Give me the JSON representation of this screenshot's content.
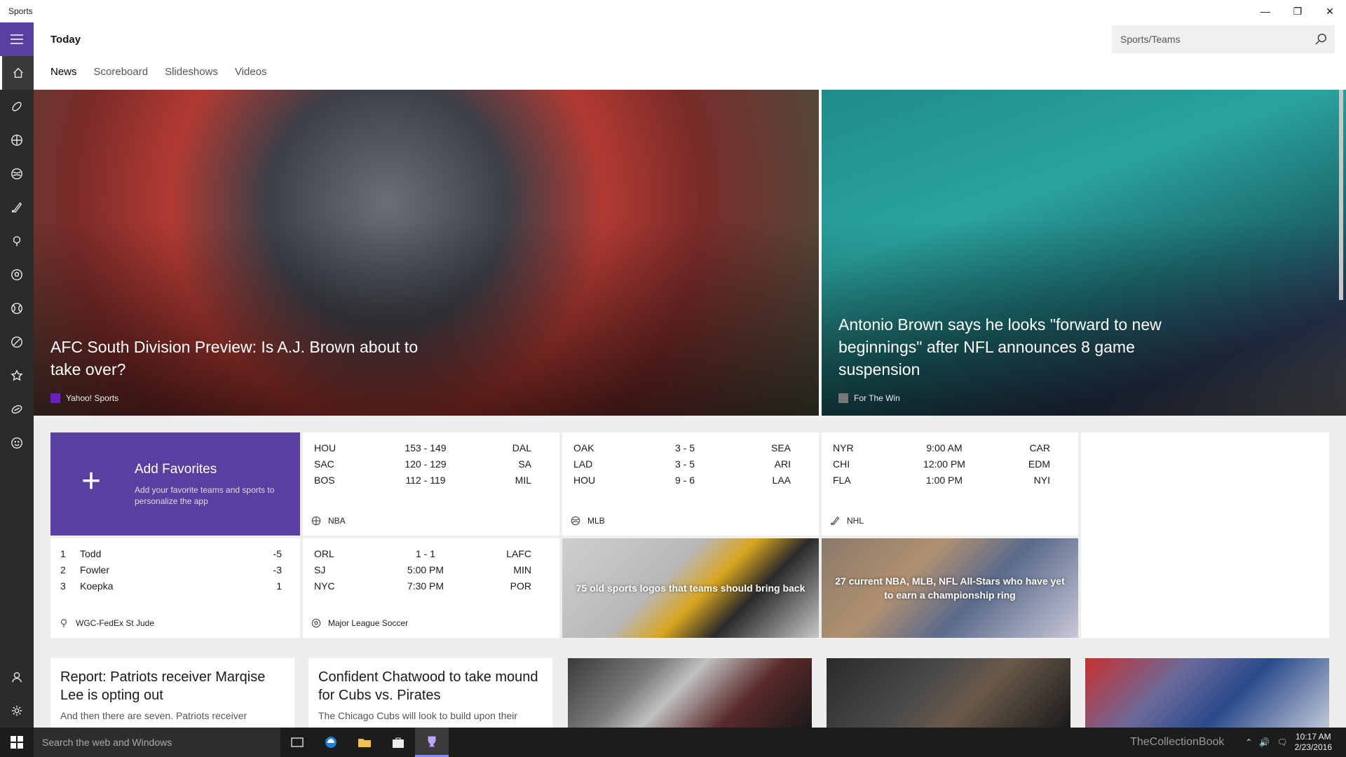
{
  "window": {
    "title": "Sports",
    "minimize": "—",
    "restore": "❐",
    "close": "✕"
  },
  "header": {
    "page_title": "Today",
    "search_placeholder": "Sports/Teams",
    "tabs": [
      {
        "label": "News",
        "active": true
      },
      {
        "label": "Scoreboard"
      },
      {
        "label": "Slideshows"
      },
      {
        "label": "Videos"
      }
    ]
  },
  "nav_icons": [
    "home-icon",
    "football-icon",
    "basketball-icon",
    "baseball-icon",
    "hockey-icon",
    "golf-icon",
    "soccer-icon",
    "tennis-icon",
    "cricket-icon",
    "fantasy-icon",
    "rugby-icon",
    "more-sports-icon"
  ],
  "hero": [
    {
      "headline": "AFC South Division Preview: Is A.J. Brown about to take over?",
      "source": "Yahoo! Sports"
    },
    {
      "headline": "Antonio Brown says he looks \"forward to new beginnings\" after NFL announces 8 game suspension",
      "source": "For The Win"
    }
  ],
  "favorites": {
    "title": "Add Favorites",
    "description": "Add your favorite teams and sports to personalize the app",
    "plus": "+"
  },
  "scoreboards": {
    "nba": {
      "league": "NBA",
      "games": [
        {
          "home": "HOU",
          "score": "153  -  149",
          "away": "DAL"
        },
        {
          "home": "SAC",
          "score": "120  -  129",
          "away": "SA"
        },
        {
          "home": "BOS",
          "score": "112  -  119",
          "away": "MIL"
        }
      ]
    },
    "mlb": {
      "league": "MLB",
      "games": [
        {
          "home": "OAK",
          "score": "3  -  5",
          "away": "SEA"
        },
        {
          "home": "LAD",
          "score": "3  -  5",
          "away": "ARI"
        },
        {
          "home": "HOU",
          "score": "9  -  6",
          "away": "LAA"
        }
      ]
    },
    "nhl": {
      "league": "NHL",
      "games": [
        {
          "home": "NYR",
          "score": "9:00 AM",
          "away": "CAR"
        },
        {
          "home": "CHI",
          "score": "12:00 PM",
          "away": "EDM"
        },
        {
          "home": "FLA",
          "score": "1:00 PM",
          "away": "NYI"
        }
      ]
    },
    "mls": {
      "league": "Major League Soccer",
      "games": [
        {
          "home": "ORL",
          "score": "1  -  1",
          "away": "LAFC"
        },
        {
          "home": "SJ",
          "score": "5:00 PM",
          "away": "MIN"
        },
        {
          "home": "NYC",
          "score": "7:30 PM",
          "away": "POR"
        }
      ]
    }
  },
  "golf": {
    "event": "WGC-FedEx St Jude",
    "leaders": [
      {
        "pos": "1",
        "name": "Todd",
        "score": "-5"
      },
      {
        "pos": "2",
        "name": "Fowler",
        "score": "-3"
      },
      {
        "pos": "3",
        "name": "Koepka",
        "score": "1"
      }
    ]
  },
  "image_tiles": [
    {
      "caption": "75 old sports logos that teams should bring back"
    },
    {
      "caption": "27 current NBA, MLB, NFL All-Stars who have yet to earn a championship ring"
    }
  ],
  "articles": [
    {
      "headline": "Report: Patriots receiver Marqise Lee is opting out",
      "snippet": "And then there are seven. Patriots receiver"
    },
    {
      "headline": "Confident Chatwood to take mound for Cubs vs. Pirates",
      "snippet": "The Chicago Cubs will look to build upon their"
    }
  ],
  "taskbar": {
    "search_placeholder": "Search the web and Windows",
    "time": "10:17 AM",
    "date": "2/23/2016",
    "watermark": "TheCollectionBook"
  },
  "colors": {
    "accent": "#5a3fa0",
    "rail": "#2b2b2b",
    "taskbar": "#1c1c1c"
  }
}
